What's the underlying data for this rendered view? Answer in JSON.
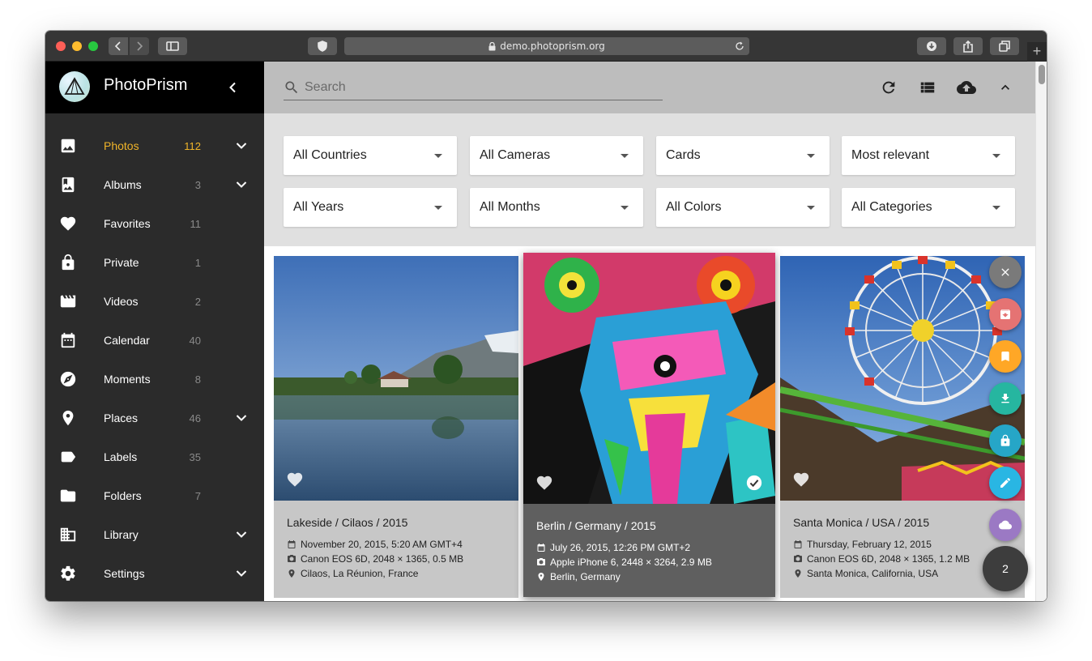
{
  "browser": {
    "url": "demo.photoprism.org"
  },
  "app": {
    "name": "PhotoPrism"
  },
  "sidebar": {
    "items": [
      {
        "label": "Photos",
        "count": "112",
        "icon": "image-icon",
        "expand": true,
        "active": true
      },
      {
        "label": "Albums",
        "count": "3",
        "icon": "photo-album-icon",
        "expand": true
      },
      {
        "label": "Favorites",
        "count": "11",
        "icon": "heart-icon",
        "expand": false
      },
      {
        "label": "Private",
        "count": "1",
        "icon": "lock-icon",
        "expand": false
      },
      {
        "label": "Videos",
        "count": "2",
        "icon": "movie-icon",
        "expand": false
      },
      {
        "label": "Calendar",
        "count": "40",
        "icon": "calendar-icon",
        "expand": false
      },
      {
        "label": "Moments",
        "count": "8",
        "icon": "compass-icon",
        "expand": false
      },
      {
        "label": "Places",
        "count": "46",
        "icon": "place-icon",
        "expand": true
      },
      {
        "label": "Labels",
        "count": "35",
        "icon": "label-icon",
        "expand": false
      },
      {
        "label": "Folders",
        "count": "7",
        "icon": "folder-icon",
        "expand": false
      },
      {
        "label": "Library",
        "count": "",
        "icon": "library-icon",
        "expand": true
      },
      {
        "label": "Settings",
        "count": "",
        "icon": "gear-icon",
        "expand": true
      }
    ],
    "active_color": "#f0b429"
  },
  "search": {
    "placeholder": "Search"
  },
  "filters": {
    "country": "All Countries",
    "camera": "All Cameras",
    "view": "Cards",
    "sort": "Most relevant",
    "year": "All Years",
    "month": "All Months",
    "color": "All Colors",
    "category": "All Categories"
  },
  "photos": [
    {
      "title": "Lakeside / Cilaos / 2015",
      "date": "November 20, 2015, 5:20 AM GMT+4",
      "camera": "Canon EOS 6D, 2048 × 1365, 0.5 MB",
      "location": "Cilaos, La Réunion, France",
      "selected": false
    },
    {
      "title": "Berlin / Germany / 2015",
      "date": "July 26, 2015, 12:26 PM GMT+2",
      "camera": "Apple iPhone 6, 2448 × 3264, 2.9 MB",
      "location": "Berlin, Germany",
      "selected": true
    },
    {
      "title": "Santa Monica / USA / 2015",
      "date": "Thursday, February 12, 2015",
      "camera": "Canon EOS 6D, 2048 × 1365, 1.2 MB",
      "location": "Santa Monica, California, USA",
      "selected": false
    }
  ],
  "selection": {
    "count": "2",
    "actions": [
      {
        "name": "close",
        "color": "#7a7a7a"
      },
      {
        "name": "archive",
        "color": "#e57373"
      },
      {
        "name": "bookmark",
        "color": "#ffa726"
      },
      {
        "name": "download",
        "color": "#26b6a0"
      },
      {
        "name": "private",
        "color": "#26a6c7"
      },
      {
        "name": "edit",
        "color": "#29b6e3"
      },
      {
        "name": "cloud",
        "color": "#9b79c4"
      }
    ]
  }
}
